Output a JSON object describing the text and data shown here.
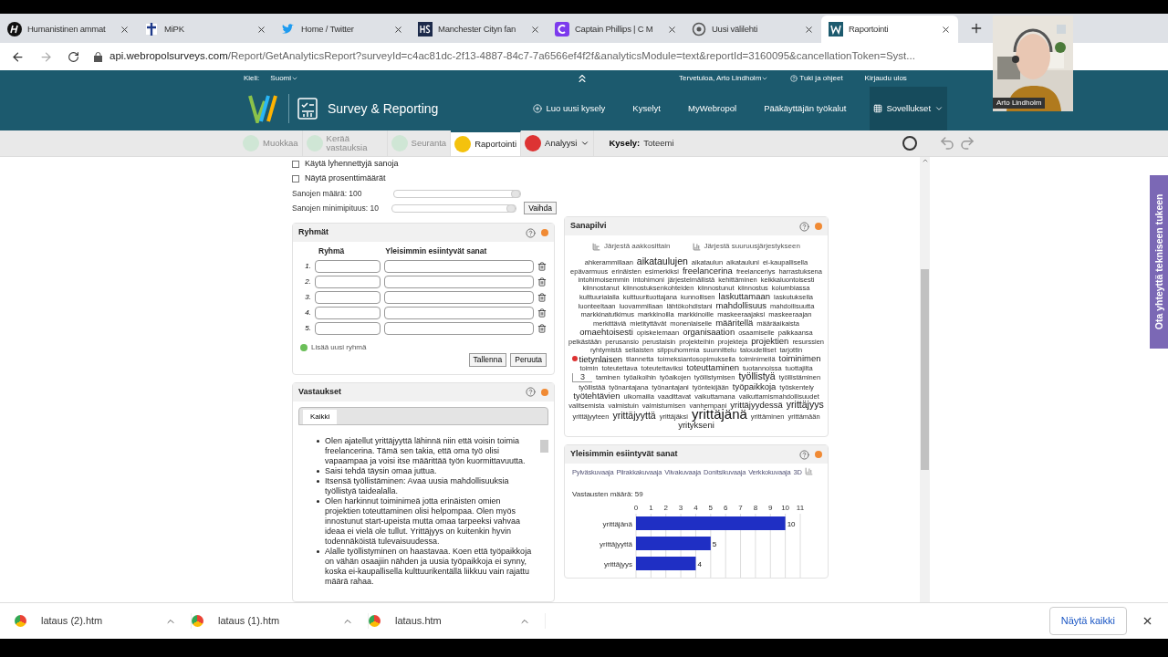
{
  "browser": {
    "tabs": [
      {
        "title": "Humanistinen ammat",
        "selected": false
      },
      {
        "title": "MiPK",
        "selected": false
      },
      {
        "title": "Home / Twitter",
        "selected": false
      },
      {
        "title": "Manchester Cityn fan",
        "selected": false
      },
      {
        "title": "Captain Phillips | C M",
        "selected": false
      },
      {
        "title": "Uusi välilehti",
        "selected": false
      },
      {
        "title": "Raportointi",
        "selected": true
      }
    ],
    "url_host": "api.webropolsurveys.com",
    "url_path": "/Report/GetAnalyticsReport?surveyId=c4ac81dc-2f13-4887-84c7-7a6566ef4f2f&analyticsModule=text&reportId=3160095&cancellationToken=Syst..."
  },
  "header": {
    "language_label": "Kieli:",
    "language": "Suomi",
    "welcome": "Tervetuloa, Arto Lindholm",
    "help": "Tuki ja ohjeet",
    "logout": "Kirjaudu ulos",
    "product": "Survey & Reporting",
    "nav": [
      {
        "label": "Luo uusi kysely",
        "selected": false
      },
      {
        "label": "Kyselyt",
        "selected": false
      },
      {
        "label": "MyWebropol",
        "selected": false
      },
      {
        "label": "Pääkäyttäjän työkalut",
        "selected": false
      },
      {
        "label": "Sovellukset",
        "selected": true
      }
    ]
  },
  "toolbar": {
    "steps": [
      {
        "label": "Muokkaa",
        "selected": false,
        "disabled": true
      },
      {
        "label": "Kerää vastauksia",
        "selected": false,
        "disabled": true
      },
      {
        "label": "Seuranta",
        "selected": false,
        "disabled": true
      },
      {
        "label": "Raportointi",
        "selected": true,
        "disabled": false
      },
      {
        "label": "Analyysi",
        "selected": false,
        "disabled": false
      }
    ],
    "survey_label": "Kysely:",
    "survey": "Toteemi"
  },
  "settings": {
    "checkboxes": [
      {
        "label": "Käytä lyhennettyjä sanoja",
        "checked": false
      },
      {
        "label": "Näytä prosenttimäärät",
        "checked": false
      }
    ],
    "sliders": [
      {
        "label": "Sanojen määrä: 100",
        "level": 1
      },
      {
        "label": "Sanojen minimipituus: 10",
        "level": 1
      }
    ],
    "apply": "Vaihda"
  },
  "groups": {
    "title": "Ryhmät",
    "col_group": "Ryhmä",
    "col_words": "Yleisimmin esiintyvät sanat",
    "rows": [
      "1.",
      "2.",
      "3.",
      "4.",
      "5."
    ],
    "add": "Lisää uusi ryhmä",
    "save": "Tallenna",
    "cancel": "Peruuta"
  },
  "answers": {
    "title": "Vastaukset",
    "tab": {
      "label": "Kaikki",
      "selected": true
    },
    "items": [
      "Olen ajatellut yrittäjyyttä lähinnä niin että voisin toimia freelancerina. Tämä sen takia, että oma työ olisi vapaampaa ja voisi itse määrittää työn kuormittavuutta.",
      "Saisi tehdä täysin omaa juttua.",
      "Itsensä työllistäminen: Avaa uusia mahdollisuuksia työllistyä taidealalla.",
      "Olen harkinnut toiminimeä jotta erinäisten omien projektien toteuttaminen olisi helpompaa. Olen myös innostunut start-upeista mutta omaa tarpeeksi vahvaa ideaa ei vielä ole tullut. Yrittäjyys on kuitenkin hyvin todennäköistä tulevaisuudessa.",
      "Alalle työllistyminen on haastavaa. Koen että työpaikkoja on vähän osaajiin nähden ja uusia työpaikkoja ei synny, koska ei-kaupallisella kulttuurikentällä liikkuu vain rajattu määrä rahaa."
    ]
  },
  "cloud": {
    "title": "Sanapilvi",
    "sort_alpha": "Järjestä aakkosittain",
    "sort_size": "Järjestä suuruusjärjestykseen",
    "tooltip": "3",
    "words": [
      {
        "w": "ahkerammillaan",
        "kind": "s"
      },
      {
        "w": "aikataulujen",
        "kind": "l"
      },
      {
        "w": "aikataulun",
        "kind": "s"
      },
      {
        "w": "aikatauluni",
        "kind": "s"
      },
      {
        "w": "ei-kaupallisella",
        "kind": "s"
      },
      {
        "w": "epävarmuus",
        "kind": "s"
      },
      {
        "w": "erinäisten",
        "kind": "s"
      },
      {
        "w": "esimerkiksi",
        "kind": "s"
      },
      {
        "w": "freelancerina",
        "kind": "m"
      },
      {
        "w": "freelanceriys",
        "kind": "s"
      },
      {
        "w": "harrastuksena",
        "kind": "s"
      },
      {
        "w": "intohimoisemmin",
        "kind": "s"
      },
      {
        "w": "intohimoni",
        "kind": "s"
      },
      {
        "w": "järjestelmällistä",
        "kind": "s"
      },
      {
        "w": "kehittäminen",
        "kind": "s"
      },
      {
        "w": "keikkaluontoisesti",
        "kind": "s"
      },
      {
        "w": "kiinnostanut",
        "kind": "s"
      },
      {
        "w": "kiinnostuksenkohteiden",
        "kind": "s"
      },
      {
        "w": "kiinnostunut",
        "kind": "s"
      },
      {
        "w": "kiinnostus",
        "kind": "s"
      },
      {
        "w": "kolumbiassa",
        "kind": "s"
      },
      {
        "w": "kulttuurialalla",
        "kind": "s"
      },
      {
        "w": "kulttuurituottajana",
        "kind": "s"
      },
      {
        "w": "kunnollisen",
        "kind": "s"
      },
      {
        "w": "laskuttamaan",
        "kind": "m"
      },
      {
        "w": "laskutuksella",
        "kind": "s"
      },
      {
        "w": "luonteeltaan",
        "kind": "s"
      },
      {
        "w": "luovammillaan",
        "kind": "s"
      },
      {
        "w": "lähtökohdistani",
        "kind": "s"
      },
      {
        "w": "mahdollisuus",
        "kind": "m"
      },
      {
        "w": "mahdollisuutta",
        "kind": "s"
      },
      {
        "w": "markkinatutkimus",
        "kind": "s"
      },
      {
        "w": "markkinoilla",
        "kind": "s"
      },
      {
        "w": "markkinoille",
        "kind": "s"
      },
      {
        "w": "maskeeraajaksi",
        "kind": "s"
      },
      {
        "w": "maskeeraajan",
        "kind": "s"
      },
      {
        "w": "merkittäviä",
        "kind": "s"
      },
      {
        "w": "mietityttävät",
        "kind": "s"
      },
      {
        "w": "monenlaiselle",
        "kind": "s"
      },
      {
        "w": "määritellä",
        "kind": "m"
      },
      {
        "w": "määräaikaista",
        "kind": "s"
      },
      {
        "w": "omaehtoisesti",
        "kind": "m"
      },
      {
        "w": "opiskelemaan",
        "kind": "s"
      },
      {
        "w": "organisaation",
        "kind": "m"
      },
      {
        "w": "osaamiselle",
        "kind": "s"
      },
      {
        "w": "palkkaansa",
        "kind": "s"
      },
      {
        "w": "pelkästään",
        "kind": "s"
      },
      {
        "w": "perusansio",
        "kind": "s"
      },
      {
        "w": "perustaisin",
        "kind": "s"
      },
      {
        "w": "projekteihin",
        "kind": "s"
      },
      {
        "w": "projekteja",
        "kind": "s"
      },
      {
        "w": "projektien",
        "kind": "m"
      },
      {
        "w": "resurssien",
        "kind": "s"
      },
      {
        "w": "ryhtymistä",
        "kind": "s"
      },
      {
        "w": "sellaisten",
        "kind": "s"
      },
      {
        "w": "silppuhommia",
        "kind": "s"
      },
      {
        "w": "suunnittelu",
        "kind": "s"
      },
      {
        "w": "taloudelliset",
        "kind": "s"
      },
      {
        "w": "tarjottin",
        "kind": "s"
      },
      {
        "w": "tietynlaisen",
        "kind": "hover"
      },
      {
        "w": "tilannetta",
        "kind": "s"
      },
      {
        "w": "toimeksiantosopimuksella",
        "kind": "s"
      },
      {
        "w": "toiminimellä",
        "kind": "s"
      },
      {
        "w": "toiminimen",
        "kind": "m"
      },
      {
        "w": "toimin",
        "kind": "s"
      },
      {
        "w": "toteutettava",
        "kind": "s"
      },
      {
        "w": "toteutettaviksi",
        "kind": "s"
      },
      {
        "w": "toteuttaminen",
        "kind": "m"
      },
      {
        "w": "tuotannoissa",
        "kind": "s"
      },
      {
        "w": "tuottajilta",
        "kind": "s"
      },
      {
        "kind": "tip"
      },
      {
        "w": "taminen",
        "kind": "s"
      },
      {
        "w": "työaikoihin",
        "kind": "s"
      },
      {
        "w": "työaikojen",
        "kind": "s"
      },
      {
        "w": "työllistymisen",
        "kind": "s"
      },
      {
        "w": "työllistyä",
        "kind": "l"
      },
      {
        "w": "työllistäminen",
        "kind": "s"
      },
      {
        "w": "työllistää",
        "kind": "s"
      },
      {
        "w": "työnantajana",
        "kind": "s"
      },
      {
        "w": "työnantajani",
        "kind": "s"
      },
      {
        "w": "työntekijään",
        "kind": "s"
      },
      {
        "w": "työpaikkoja",
        "kind": "m"
      },
      {
        "w": "työskentely",
        "kind": "s"
      },
      {
        "w": "työtehtävien",
        "kind": "m"
      },
      {
        "w": "ulkomailla",
        "kind": "s"
      },
      {
        "w": "vaadittavat",
        "kind": "s"
      },
      {
        "w": "vaikuttamana",
        "kind": "s"
      },
      {
        "w": "vaikuttamismahdollisuudet",
        "kind": "s"
      },
      {
        "w": "valitsemista",
        "kind": "s"
      },
      {
        "w": "valmistuin",
        "kind": "s"
      },
      {
        "w": "valmistumisen",
        "kind": "s"
      },
      {
        "w": "vanhempani",
        "kind": "s"
      },
      {
        "w": "yrittäjyydessä",
        "kind": "m"
      },
      {
        "w": "yrittäjyys",
        "kind": "l"
      },
      {
        "w": "yrittäjyyteen",
        "kind": "s"
      },
      {
        "w": "yrittäjyyttä",
        "kind": "l"
      },
      {
        "w": "yrittäjäksi",
        "kind": "s"
      },
      {
        "w": "yrittäjänä",
        "kind": "xl"
      },
      {
        "w": "yrittäminen",
        "kind": "s"
      },
      {
        "w": "yrittämään",
        "kind": "s"
      },
      {
        "w": "yritykseni",
        "kind": "m"
      }
    ]
  },
  "frequent": {
    "title": "Yleisimmin esiintyvät sanat",
    "chart_types": [
      "Pylväskuvaaja",
      "Piirakkakuvaaja",
      "Viivakuvaaja",
      "Donitsikuvaaja",
      "Verkkokuvaaja",
      "3D"
    ],
    "count": "Vastausten määrä: 59",
    "chart_data": {
      "type": "bar",
      "orientation": "horizontal",
      "grid": true,
      "categories": [
        "yrittäjänä",
        "yrittäjyyttä",
        "yrittäjyys"
      ],
      "series": [
        {
          "color": "#1f2fc4",
          "values": [
            10,
            5,
            4
          ]
        }
      ],
      "xlim": [
        0,
        11
      ],
      "xticks": [
        0,
        1,
        2,
        3,
        4,
        5,
        6,
        7,
        8,
        9,
        10,
        11
      ],
      "data_labels": true
    }
  },
  "support_tab": "Ota yhteyttä tekniseen tukeen",
  "downloads": {
    "files": [
      "lataus (2).htm",
      "lataus (1).htm",
      "lataus.htm"
    ],
    "show_all": "Näytä kaikki"
  },
  "video": {
    "kind": "picture",
    "name": "Arto Lindholm"
  }
}
